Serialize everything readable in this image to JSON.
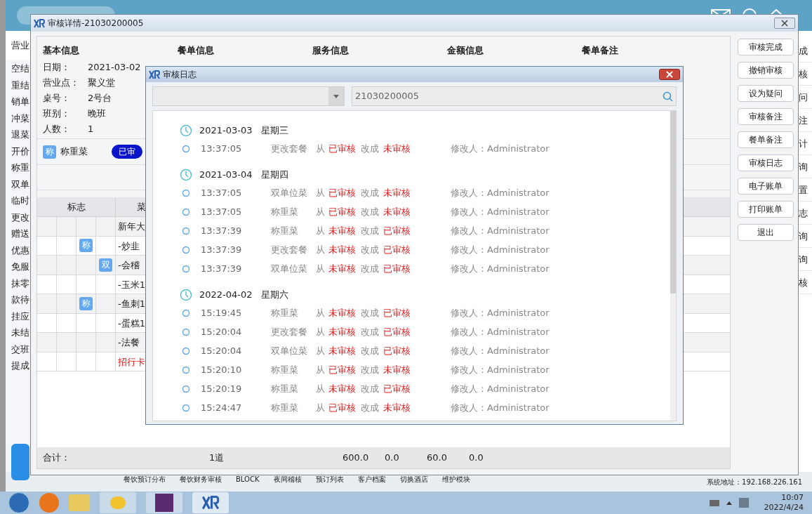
{
  "background_app": {
    "sidebar_header": "营业",
    "sidebar_items": [
      "空结",
      "重结",
      "销单",
      "冲菜",
      "退菜",
      "开价",
      "称重",
      "双单",
      "临时",
      "更改",
      "赠送",
      "优惠",
      "免服",
      "抹零",
      "款待",
      "挂应",
      "未结",
      "交班",
      "提成"
    ],
    "right_items": [
      "成",
      "核",
      "问",
      "注",
      "计",
      "询",
      "置",
      "志",
      "询",
      "询",
      "核"
    ],
    "bottom_menu": [
      "餐饮预订分布",
      "餐饮财务审核",
      "BLOCK",
      "夜间稽核",
      "预订列表",
      "客户档案",
      "切换酒店",
      "维护模块"
    ],
    "system_address": "系统地址：192.168.226.161"
  },
  "audit_window": {
    "title": "审核详情-21030200005",
    "sections": [
      "基本信息",
      "餐单信息",
      "服务信息",
      "金额信息",
      "餐单备注"
    ],
    "basic_info": [
      {
        "label": "日期：",
        "value": "2021-03-02"
      },
      {
        "label": "营业点：",
        "value": "聚义堂"
      },
      {
        "label": "桌号：",
        "value": "2号台"
      },
      {
        "label": "班别：",
        "value": "晚班"
      },
      {
        "label": "人数：",
        "value": "1"
      }
    ],
    "audit_item": {
      "badge": "称",
      "name": "称重菜",
      "status": "已审"
    },
    "table": {
      "columns": [
        "标志",
        "菜"
      ],
      "rows": [
        {
          "name": "新年大",
          "kind": "normal"
        },
        {
          "name": "-炒韭",
          "kind": "normal",
          "flag_weigh": "称"
        },
        {
          "name": "-会稽",
          "kind": "normal",
          "flag_double": "双"
        },
        {
          "name": "-玉米1",
          "kind": "normal"
        },
        {
          "name": "-鱼刺1",
          "kind": "normal",
          "flag_weigh": "称"
        },
        {
          "name": "-蛋糕1",
          "kind": "normal"
        },
        {
          "name": "-法餐",
          "kind": "normal"
        },
        {
          "name": "招行卡",
          "kind": "payment"
        }
      ]
    },
    "totals": {
      "label": "合计：",
      "count": "1道",
      "values": [
        "600.0",
        "0.0",
        "60.0",
        "0.0"
      ]
    },
    "buttons": [
      "审核完成",
      "撤销审核",
      "设为疑问",
      "审核备注",
      "餐单备注",
      "审核日志",
      "电子账单",
      "打印账单",
      "退出"
    ]
  },
  "log_window": {
    "title": "审核日志",
    "search": {
      "value": "21030200005"
    },
    "groups": [
      {
        "date": "2021-03-03",
        "weekday": "星期三",
        "entries": [
          {
            "time": "13:37:05",
            "action": "更改套餐",
            "from_word": "从",
            "from": "已审核",
            "to_word": "改成",
            "to": "未审核",
            "editor": "修改人：Administrator"
          }
        ]
      },
      {
        "date": "2021-03-04",
        "weekday": "星期四",
        "entries": [
          {
            "time": "13:37:05",
            "action": "双单位菜",
            "from_word": "从",
            "from": "已审核",
            "to_word": "改成",
            "to": "未审核",
            "editor": "修改人：Administrator"
          },
          {
            "time": "13:37:05",
            "action": "称重菜",
            "from_word": "从",
            "from": "已审核",
            "to_word": "改成",
            "to": "未审核",
            "editor": "修改人：Administrator"
          },
          {
            "time": "13:37:39",
            "action": "称重菜",
            "from_word": "从",
            "from": "未审核",
            "to_word": "改成",
            "to": "已审核",
            "editor": "修改人：Administrator"
          },
          {
            "time": "13:37:39",
            "action": "更改套餐",
            "from_word": "从",
            "from": "未审核",
            "to_word": "改成",
            "to": "已审核",
            "editor": "修改人：Administrator"
          },
          {
            "time": "13:37:39",
            "action": "双单位菜",
            "from_word": "从",
            "from": "未审核",
            "to_word": "改成",
            "to": "已审核",
            "editor": "修改人：Administrator"
          }
        ]
      },
      {
        "date": "2022-04-02",
        "weekday": "星期六",
        "entries": [
          {
            "time": "15:19:45",
            "action": "称重菜",
            "from_word": "从",
            "from": "未审核",
            "to_word": "改成",
            "to": "已审核",
            "editor": "修改人：Administrator"
          },
          {
            "time": "15:20:04",
            "action": "更改套餐",
            "from_word": "从",
            "from": "未审核",
            "to_word": "改成",
            "to": "已审核",
            "editor": "修改人：Administrator"
          },
          {
            "time": "15:20:04",
            "action": "双单位菜",
            "from_word": "从",
            "from": "未审核",
            "to_word": "改成",
            "to": "已审核",
            "editor": "修改人：Administrator"
          },
          {
            "time": "15:20:10",
            "action": "称重菜",
            "from_word": "从",
            "from": "已审核",
            "to_word": "改成",
            "to": "未审核",
            "editor": "修改人：Administrator"
          },
          {
            "time": "15:20:19",
            "action": "称重菜",
            "from_word": "从",
            "from": "未审核",
            "to_word": "改成",
            "to": "已审核",
            "editor": "修改人：Administrator"
          },
          {
            "time": "15:24:47",
            "action": "称重菜",
            "from_word": "从",
            "from": "已审核",
            "to_word": "改成",
            "to": "未审核",
            "editor": "修改人：Administrator"
          }
        ]
      }
    ]
  },
  "taskbar": {
    "time": "10:07",
    "date": "2022/4/24"
  }
}
